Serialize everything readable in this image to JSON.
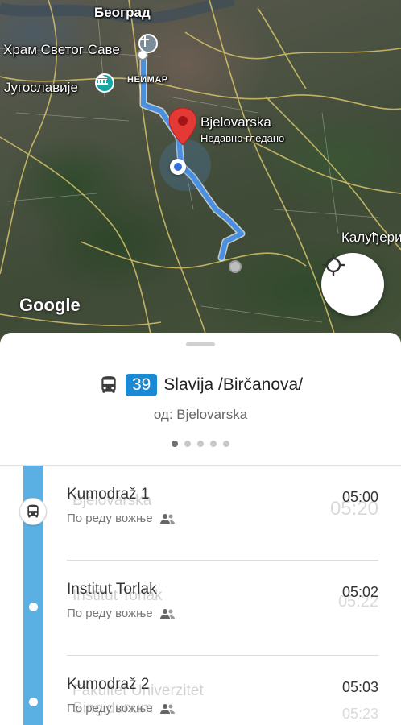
{
  "map": {
    "labels": {
      "city": "Београд",
      "church": "Храм Светог Саве",
      "yugo": "Југославије",
      "neimar": "НЕИМАР",
      "destination": "Bjelovarska",
      "destination_sub": "Недавно гледано",
      "kaludj": "Калуђери"
    },
    "logo": "Google",
    "route_color": "#4a90e2",
    "pin_color": "#e53935"
  },
  "route": {
    "number": "39",
    "name": "Slavija /Birčanova/",
    "from": "од: Bjelovarska",
    "pages": 5,
    "active_page": 0,
    "badge_color": "#1a8ad6"
  },
  "stops": [
    {
      "name": "Kumodraž 1",
      "ghost_name": "Bjelovarska",
      "subtitle": "По реду вожње",
      "time": "05:00",
      "ghost_time": "05:20",
      "icon": "bus-icon"
    },
    {
      "name": "Institut Torlak",
      "ghost_name": "Institut Torlak",
      "subtitle": "По реду вожње",
      "time": "05:02",
      "ghost_time": "05:22",
      "icon": "dot"
    },
    {
      "name": "Kumodraž 2",
      "ghost_name": "Fakultet Univerzitet Singidunum",
      "subtitle": "По реду вожње",
      "time": "05:03",
      "ghost_time": "05:23",
      "icon": "dot"
    }
  ]
}
